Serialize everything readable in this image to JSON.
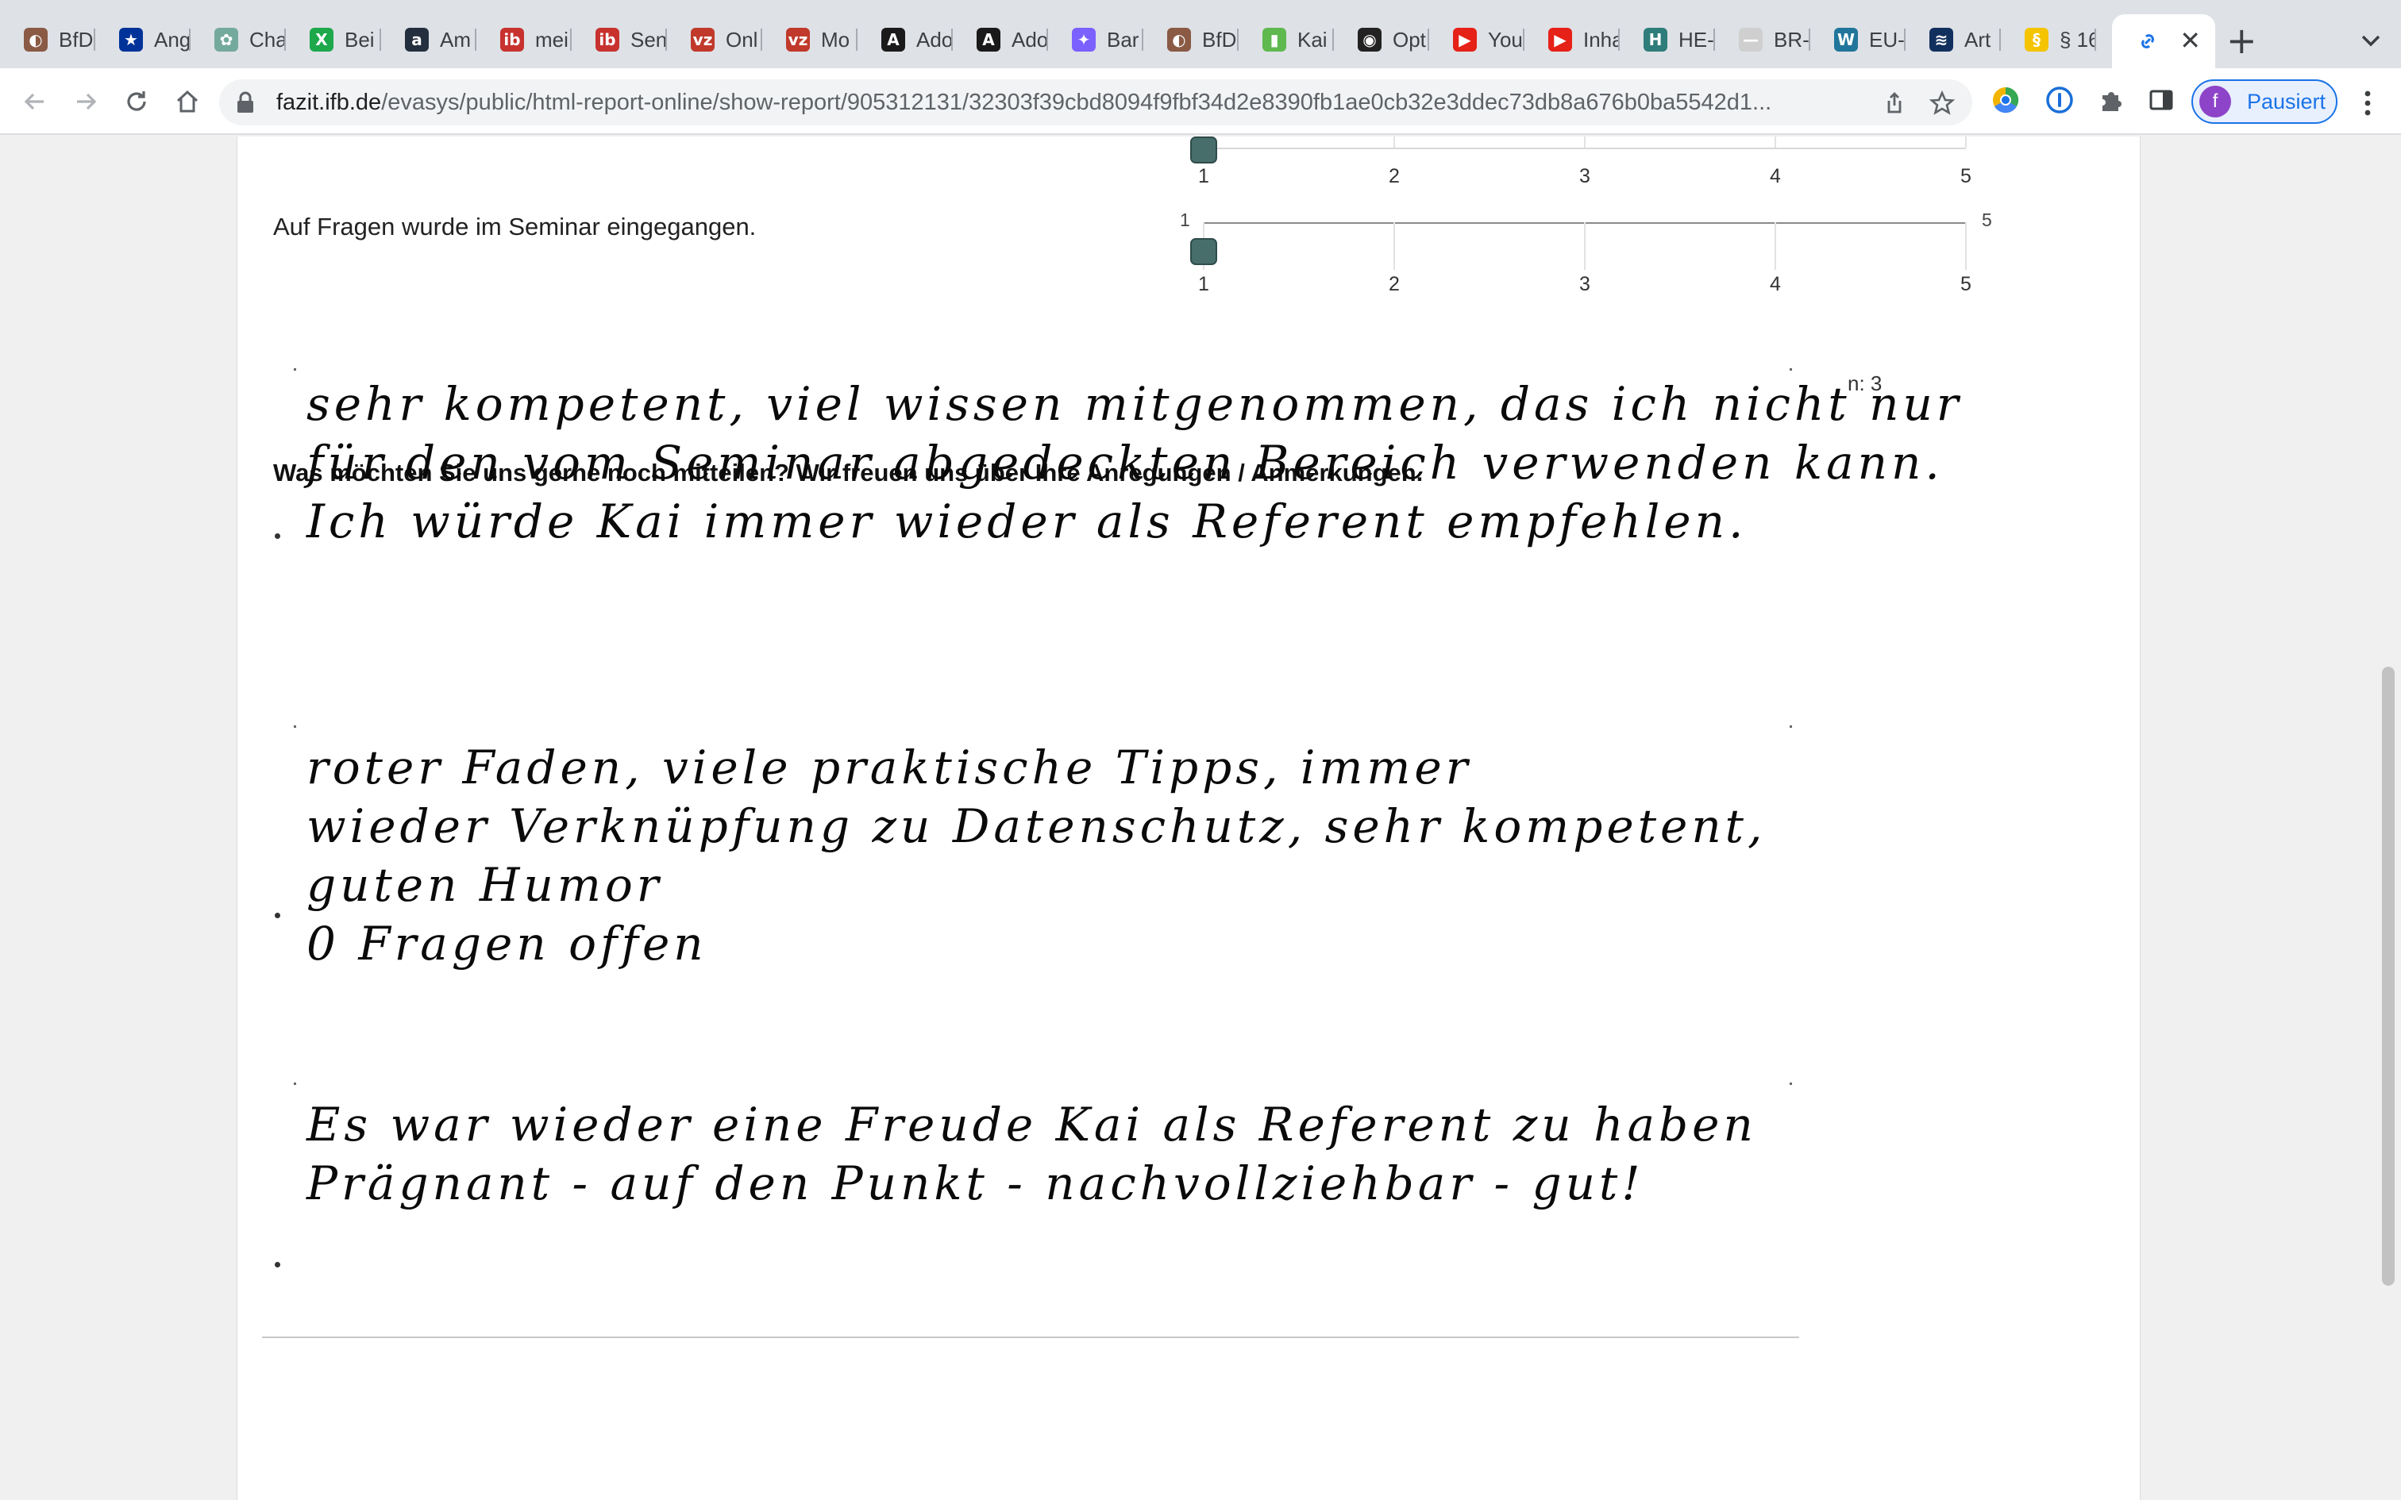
{
  "browser": {
    "tabs": [
      {
        "title": "BfD",
        "color": "#8a5a44",
        "glyph": "◐"
      },
      {
        "title": "Ang",
        "color": "#003399",
        "glyph": "★"
      },
      {
        "title": "Cha",
        "color": "#74aa9c",
        "glyph": "✿"
      },
      {
        "title": "Bei",
        "color": "#1da84c",
        "glyph": "X"
      },
      {
        "title": "Am",
        "color": "#232f3e",
        "glyph": "a"
      },
      {
        "title": "mei",
        "color": "#c7322f",
        "glyph": "ib"
      },
      {
        "title": "Sen",
        "color": "#c7322f",
        "glyph": "ib"
      },
      {
        "title": "Onl",
        "color": "#c0392b",
        "glyph": "vz"
      },
      {
        "title": "Mo",
        "color": "#c0392b",
        "glyph": "vz"
      },
      {
        "title": "Ado",
        "color": "#1a1a1a",
        "glyph": "A"
      },
      {
        "title": "Ado",
        "color": "#1a1a1a",
        "glyph": "A"
      },
      {
        "title": "Bar",
        "color": "#7b61ff",
        "glyph": "✦"
      },
      {
        "title": "BfD",
        "color": "#8a5a44",
        "glyph": "◐"
      },
      {
        "title": "Kai",
        "color": "#5fb94f",
        "glyph": "▮"
      },
      {
        "title": "Opt",
        "color": "#222222",
        "glyph": "◉"
      },
      {
        "title": "You",
        "color": "#e62117",
        "glyph": "▶"
      },
      {
        "title": "Inha",
        "color": "#e62117",
        "glyph": "▶"
      },
      {
        "title": "HE-",
        "color": "#2e7d7a",
        "glyph": "H"
      },
      {
        "title": "BR-",
        "color": "#cfcfcf",
        "glyph": "—"
      },
      {
        "title": "EU-",
        "color": "#21759b",
        "glyph": "W"
      },
      {
        "title": "Art",
        "color": "#12305e",
        "glyph": "≋"
      },
      {
        "title": "§ 16",
        "color": "#f5c400",
        "glyph": "§"
      }
    ],
    "active_tab_close": "✕",
    "new_tab": "+",
    "url_host": "fazit.ifb.de",
    "url_path": "/evasys/public/html-report-online/show-report/905312131/32303f39cbd8094f9fbf34d2e8390fb1ae0cb32e3ddec73db8a676b0ba5542d1...",
    "profile_initial": "f",
    "profile_label": "Pausiert"
  },
  "report": {
    "question_above_label": "",
    "question_label": "Auf Fragen wurde im Seminar eingegangen.",
    "scale_ticks": [
      "1",
      "2",
      "3",
      "4",
      "5"
    ],
    "scale_min_label": "1",
    "scale_max_label": "5",
    "scale_1_value": 1,
    "scale_2_value": 1,
    "comments_heading": "Was möchten Sie uns gerne noch mitteilen? Wir freuen uns über Ihre Anregungen / Anmerkungen.",
    "n_label": "n: 3",
    "comments": [
      {
        "lines": [
          "sehr kompetent, viel wissen mitgenommen, das ich nicht nur",
          "für den vom Seminar abgedeckten Bereich verwenden kann.",
          "Ich würde Kai immer wieder als Referent empfehlen."
        ]
      },
      {
        "lines": [
          "roter Faden, viele praktische Tipps, immer",
          "wieder Verknüpfung zu Datenschutz, sehr kompetent,",
          "guten Humor",
          "0 Fragen offen"
        ]
      },
      {
        "lines": [
          "Es war wieder eine Freude Kai als Referent zu haben",
          "Prägnant - auf den Punkt - nachvollziehbar - gut!"
        ]
      }
    ]
  }
}
